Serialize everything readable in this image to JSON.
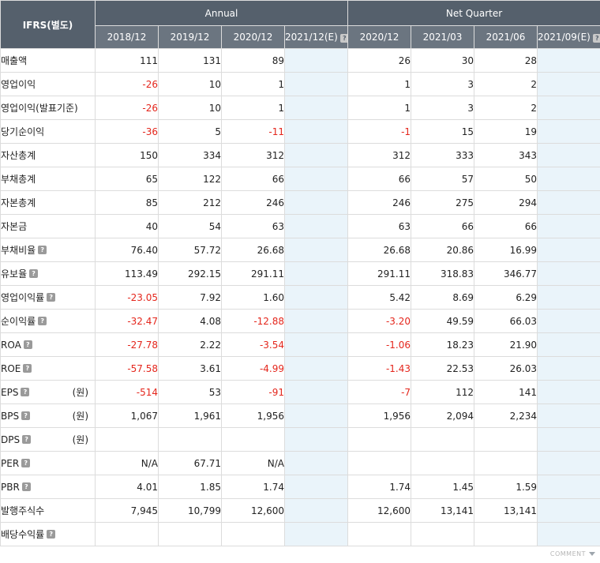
{
  "header": {
    "corner": "IFRS(별도)",
    "annual": "Annual",
    "quarter": "Net Quarter",
    "periods": [
      "2018/12",
      "2019/12",
      "2020/12",
      "2021/12(E)",
      "2020/12",
      "2021/03",
      "2021/06",
      "2021/09(E)"
    ],
    "help_glyph": "?"
  },
  "rows": [
    {
      "label": "매출액",
      "help": false,
      "unit": "",
      "values": [
        "111",
        "131",
        "89",
        "",
        "26",
        "30",
        "28",
        ""
      ]
    },
    {
      "label": "영업이익",
      "help": false,
      "unit": "",
      "values": [
        "-26",
        "10",
        "1",
        "",
        "1",
        "3",
        "2",
        ""
      ]
    },
    {
      "label": "영업이익(발표기준)",
      "help": false,
      "unit": "",
      "values": [
        "-26",
        "10",
        "1",
        "",
        "1",
        "3",
        "2",
        ""
      ]
    },
    {
      "label": "당기순이익",
      "help": false,
      "unit": "",
      "values": [
        "-36",
        "5",
        "-11",
        "",
        "-1",
        "15",
        "19",
        ""
      ]
    },
    {
      "label": "자산총계",
      "help": false,
      "unit": "",
      "values": [
        "150",
        "334",
        "312",
        "",
        "312",
        "333",
        "343",
        ""
      ]
    },
    {
      "label": "부채총계",
      "help": false,
      "unit": "",
      "values": [
        "65",
        "122",
        "66",
        "",
        "66",
        "57",
        "50",
        ""
      ]
    },
    {
      "label": "자본총계",
      "help": false,
      "unit": "",
      "values": [
        "85",
        "212",
        "246",
        "",
        "246",
        "275",
        "294",
        ""
      ]
    },
    {
      "label": "자본금",
      "help": false,
      "unit": "",
      "values": [
        "40",
        "54",
        "63",
        "",
        "63",
        "66",
        "66",
        ""
      ]
    },
    {
      "label": "부채비율",
      "help": true,
      "unit": "",
      "values": [
        "76.40",
        "57.72",
        "26.68",
        "",
        "26.68",
        "20.86",
        "16.99",
        ""
      ]
    },
    {
      "label": "유보율",
      "help": true,
      "unit": "",
      "values": [
        "113.49",
        "292.15",
        "291.11",
        "",
        "291.11",
        "318.83",
        "346.77",
        ""
      ]
    },
    {
      "label": "영업이익률",
      "help": true,
      "unit": "",
      "values": [
        "-23.05",
        "7.92",
        "1.60",
        "",
        "5.42",
        "8.69",
        "6.29",
        ""
      ]
    },
    {
      "label": "순이익률",
      "help": true,
      "unit": "",
      "values": [
        "-32.47",
        "4.08",
        "-12.88",
        "",
        "-3.20",
        "49.59",
        "66.03",
        ""
      ]
    },
    {
      "label": "ROA",
      "help": true,
      "unit": "",
      "values": [
        "-27.78",
        "2.22",
        "-3.54",
        "",
        "-1.06",
        "18.23",
        "21.90",
        ""
      ]
    },
    {
      "label": "ROE",
      "help": true,
      "unit": "",
      "values": [
        "-57.58",
        "3.61",
        "-4.99",
        "",
        "-1.43",
        "22.53",
        "26.03",
        ""
      ]
    },
    {
      "label": "EPS",
      "help": true,
      "unit": "(원)",
      "values": [
        "-514",
        "53",
        "-91",
        "",
        "-7",
        "112",
        "141",
        ""
      ]
    },
    {
      "label": "BPS",
      "help": true,
      "unit": "(원)",
      "values": [
        "1,067",
        "1,961",
        "1,956",
        "",
        "1,956",
        "2,094",
        "2,234",
        ""
      ]
    },
    {
      "label": "DPS",
      "help": true,
      "unit": "(원)",
      "values": [
        "",
        "",
        "",
        "",
        "",
        "",
        "",
        ""
      ]
    },
    {
      "label": "PER",
      "help": true,
      "unit": "",
      "values": [
        "N/A",
        "67.71",
        "N/A",
        "",
        "",
        "",
        "",
        ""
      ]
    },
    {
      "label": "PBR",
      "help": true,
      "unit": "",
      "values": [
        "4.01",
        "1.85",
        "1.74",
        "",
        "1.74",
        "1.45",
        "1.59",
        ""
      ]
    },
    {
      "label": "발행주식수",
      "help": false,
      "unit": "",
      "values": [
        "7,945",
        "10,799",
        "12,600",
        "",
        "12,600",
        "13,141",
        "13,141",
        ""
      ]
    },
    {
      "label": "배당수익률",
      "help": true,
      "unit": "",
      "values": [
        "",
        "",
        "",
        "",
        "",
        "",
        "",
        ""
      ]
    }
  ],
  "footer": {
    "comment_label": "COMMENT",
    "arrow_icon": "chevron-down-icon"
  },
  "colors": {
    "header_bg": "#55606c",
    "period_bg": "#6b7580",
    "negative": "#e4261c",
    "estimate_bg": "#eaf4fa"
  }
}
